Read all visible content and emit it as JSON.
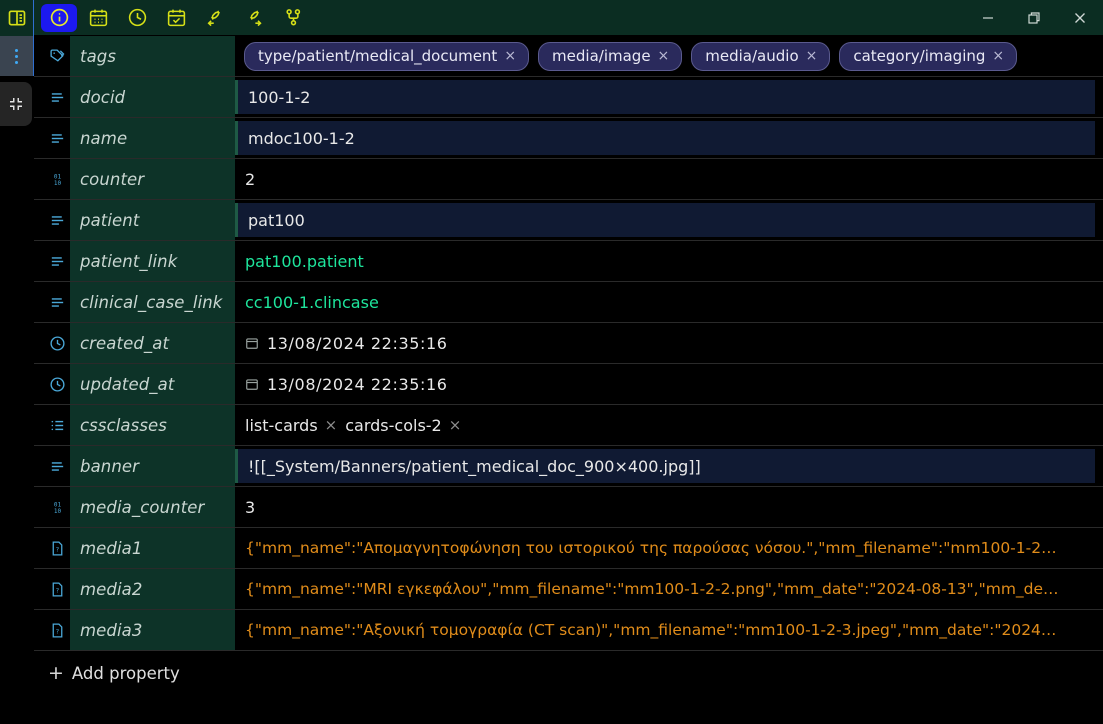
{
  "window": {
    "ribbon_toggle_icon": "sidebar-toggle-icon",
    "minimize_label": "–",
    "maximize_label": "❐",
    "close_label": "✕",
    "tabs": [
      {
        "name": "info",
        "icon": "info-circle-icon",
        "active": true
      },
      {
        "name": "calendar",
        "icon": "calendar-icon",
        "active": false
      },
      {
        "name": "clock",
        "icon": "clock-icon",
        "active": false
      },
      {
        "name": "calendar-check",
        "icon": "calendar-check-icon",
        "active": false
      },
      {
        "name": "backlinks",
        "icon": "link-arrow-left-icon",
        "active": false
      },
      {
        "name": "outgoing-links",
        "icon": "link-arrow-right-icon",
        "active": false
      },
      {
        "name": "graph",
        "icon": "git-branch-icon",
        "active": false
      }
    ]
  },
  "rail": {
    "more_icon": "vertical-dots-icon",
    "collapse_icon": "collapse-corners-icon"
  },
  "properties": [
    {
      "key": "tags",
      "icon": "tag-icon",
      "type": "tags",
      "chips": [
        "type/patient/medical_document",
        "media/image",
        "media/audio",
        "category/imaging"
      ],
      "remove_label": "×"
    },
    {
      "key": "docid",
      "icon": "text-lines-icon",
      "type": "text-filled",
      "value": "100-1-2"
    },
    {
      "key": "name",
      "icon": "text-lines-icon",
      "type": "text-filled",
      "value": "mdoc100-1-2"
    },
    {
      "key": "counter",
      "icon": "number-icon",
      "type": "text-plain",
      "value": "2"
    },
    {
      "key": "patient",
      "icon": "text-lines-icon",
      "type": "text-filled",
      "value": "pat100"
    },
    {
      "key": "patient_link",
      "icon": "text-lines-icon",
      "type": "link",
      "value": "pat100.patient"
    },
    {
      "key": "clinical_case_link",
      "icon": "text-lines-icon",
      "type": "link",
      "value": "cc100-1.clincase"
    },
    {
      "key": "created_at",
      "icon": "clock-icon",
      "type": "date",
      "value": "13/08/2024 22:35:16",
      "date_icon": "calendar-small-icon"
    },
    {
      "key": "updated_at",
      "icon": "clock-icon",
      "type": "date",
      "value": "13/08/2024 22:35:16",
      "date_icon": "calendar-small-icon"
    },
    {
      "key": "cssclasses",
      "icon": "list-icon",
      "type": "list",
      "items": [
        "list-cards",
        "cards-cols-2"
      ],
      "remove_label": "×"
    },
    {
      "key": "banner",
      "icon": "text-lines-icon",
      "type": "text-filled",
      "value": "![[_System/Banners/patient_medical_doc_900×400.jpg]]"
    },
    {
      "key": "media_counter",
      "icon": "number-icon",
      "type": "text-plain",
      "value": "3"
    },
    {
      "key": "media1",
      "icon": "file-question-icon",
      "type": "json",
      "value": "{\"mm_name\":\"Απομαγνητοφώνηση του ιστορικού της παρούσας νόσου.\",\"mm_filename\":\"mm100-1-2…"
    },
    {
      "key": "media2",
      "icon": "file-question-icon",
      "type": "json",
      "value": "{\"mm_name\":\"MRI εγκεφάλου\",\"mm_filename\":\"mm100-1-2-2.png\",\"mm_date\":\"2024-08-13\",\"mm_de…"
    },
    {
      "key": "media3",
      "icon": "file-question-icon",
      "type": "json",
      "value": "{\"mm_name\":\"Αξονική τομογραφία (CT scan)\",\"mm_filename\":\"mm100-1-2-3.jpeg\",\"mm_date\":\"2024…"
    }
  ],
  "footer": {
    "add_property_label": "Add property",
    "add_property_plus": "+"
  },
  "colors": {
    "titlebar_bg": "#0b2d22",
    "key_bg": "#0d3328",
    "value_filled_bg": "#101a33",
    "accent_tab": "#1c19f0",
    "icon_yellow": "#d6e017",
    "icon_blue": "#3fa9f5",
    "link_green": "#1ee59c",
    "json_orange": "#e08c1a",
    "chip_bg": "#2a2a5c"
  }
}
